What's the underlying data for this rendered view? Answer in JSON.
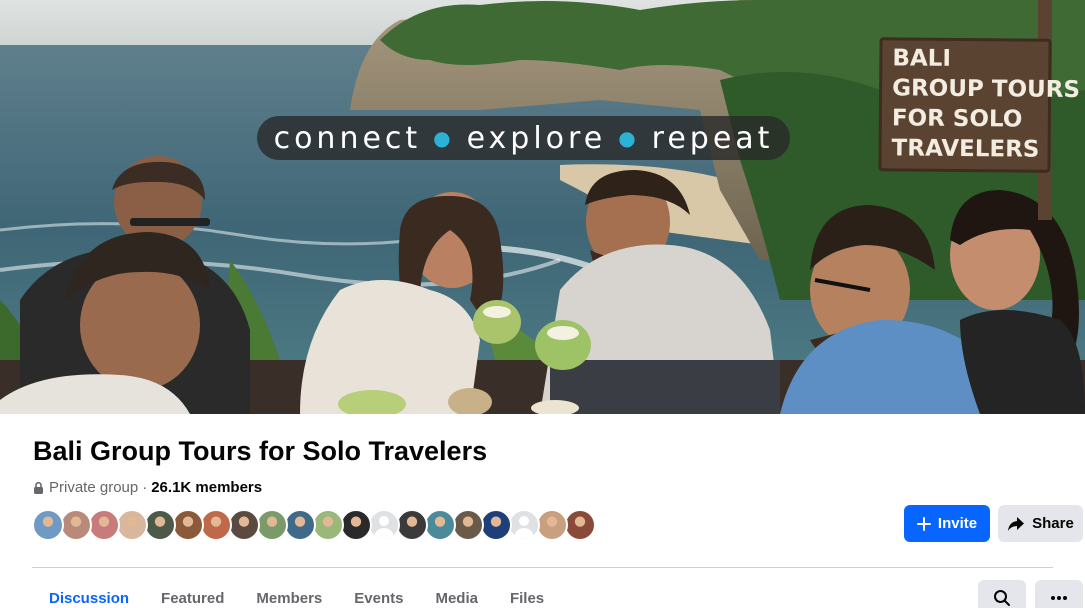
{
  "cover": {
    "tagline_words": [
      "connect",
      "explore",
      "repeat"
    ],
    "sign_lines": [
      "BALI",
      "GROUP TOURS",
      "FOR SOLO",
      "TRAVELERS"
    ]
  },
  "group": {
    "name": "Bali Group Tours for Solo Travelers",
    "privacy": "Private group",
    "separator": "·",
    "member_count": "26.1K members"
  },
  "member_avatars": [
    {
      "color": "#6f9ac4"
    },
    {
      "color": "#b98a7a"
    },
    {
      "color": "#c77b7b"
    },
    {
      "color": "#d8b79c"
    },
    {
      "color": "#4d5a4a"
    },
    {
      "color": "#8a5a3a"
    },
    {
      "color": "#c0684a"
    },
    {
      "color": "#5a4a40"
    },
    {
      "color": "#7a9a6a"
    },
    {
      "color": "#3f6a8a"
    },
    {
      "color": "#9ab87a"
    },
    {
      "color": "#2a2a2a"
    },
    {
      "placeholder": true
    },
    {
      "color": "#3a3a3a"
    },
    {
      "color": "#4a8a9a"
    },
    {
      "color": "#6a5a4a"
    },
    {
      "color": "#1f3f7a"
    },
    {
      "placeholder": true
    },
    {
      "color": "#c8a080"
    },
    {
      "color": "#8a4a3a"
    }
  ],
  "actions": {
    "invite_label": "Invite",
    "share_label": "Share"
  },
  "tabs": [
    {
      "label": "Discussion",
      "active": true
    },
    {
      "label": "Featured",
      "active": false
    },
    {
      "label": "Members",
      "active": false
    },
    {
      "label": "Events",
      "active": false
    },
    {
      "label": "Media",
      "active": false
    },
    {
      "label": "Files",
      "active": false
    }
  ],
  "colors": {
    "accent": "#0866ff",
    "secondary_button": "#e4e6eb",
    "muted_text": "#65676b",
    "tagline_dot": "#2bb3d6"
  },
  "icons": {
    "privacy": "lock-icon",
    "invite": "plus-icon",
    "share": "share-arrow-icon",
    "search": "search-icon",
    "more": "more-dots-icon"
  }
}
